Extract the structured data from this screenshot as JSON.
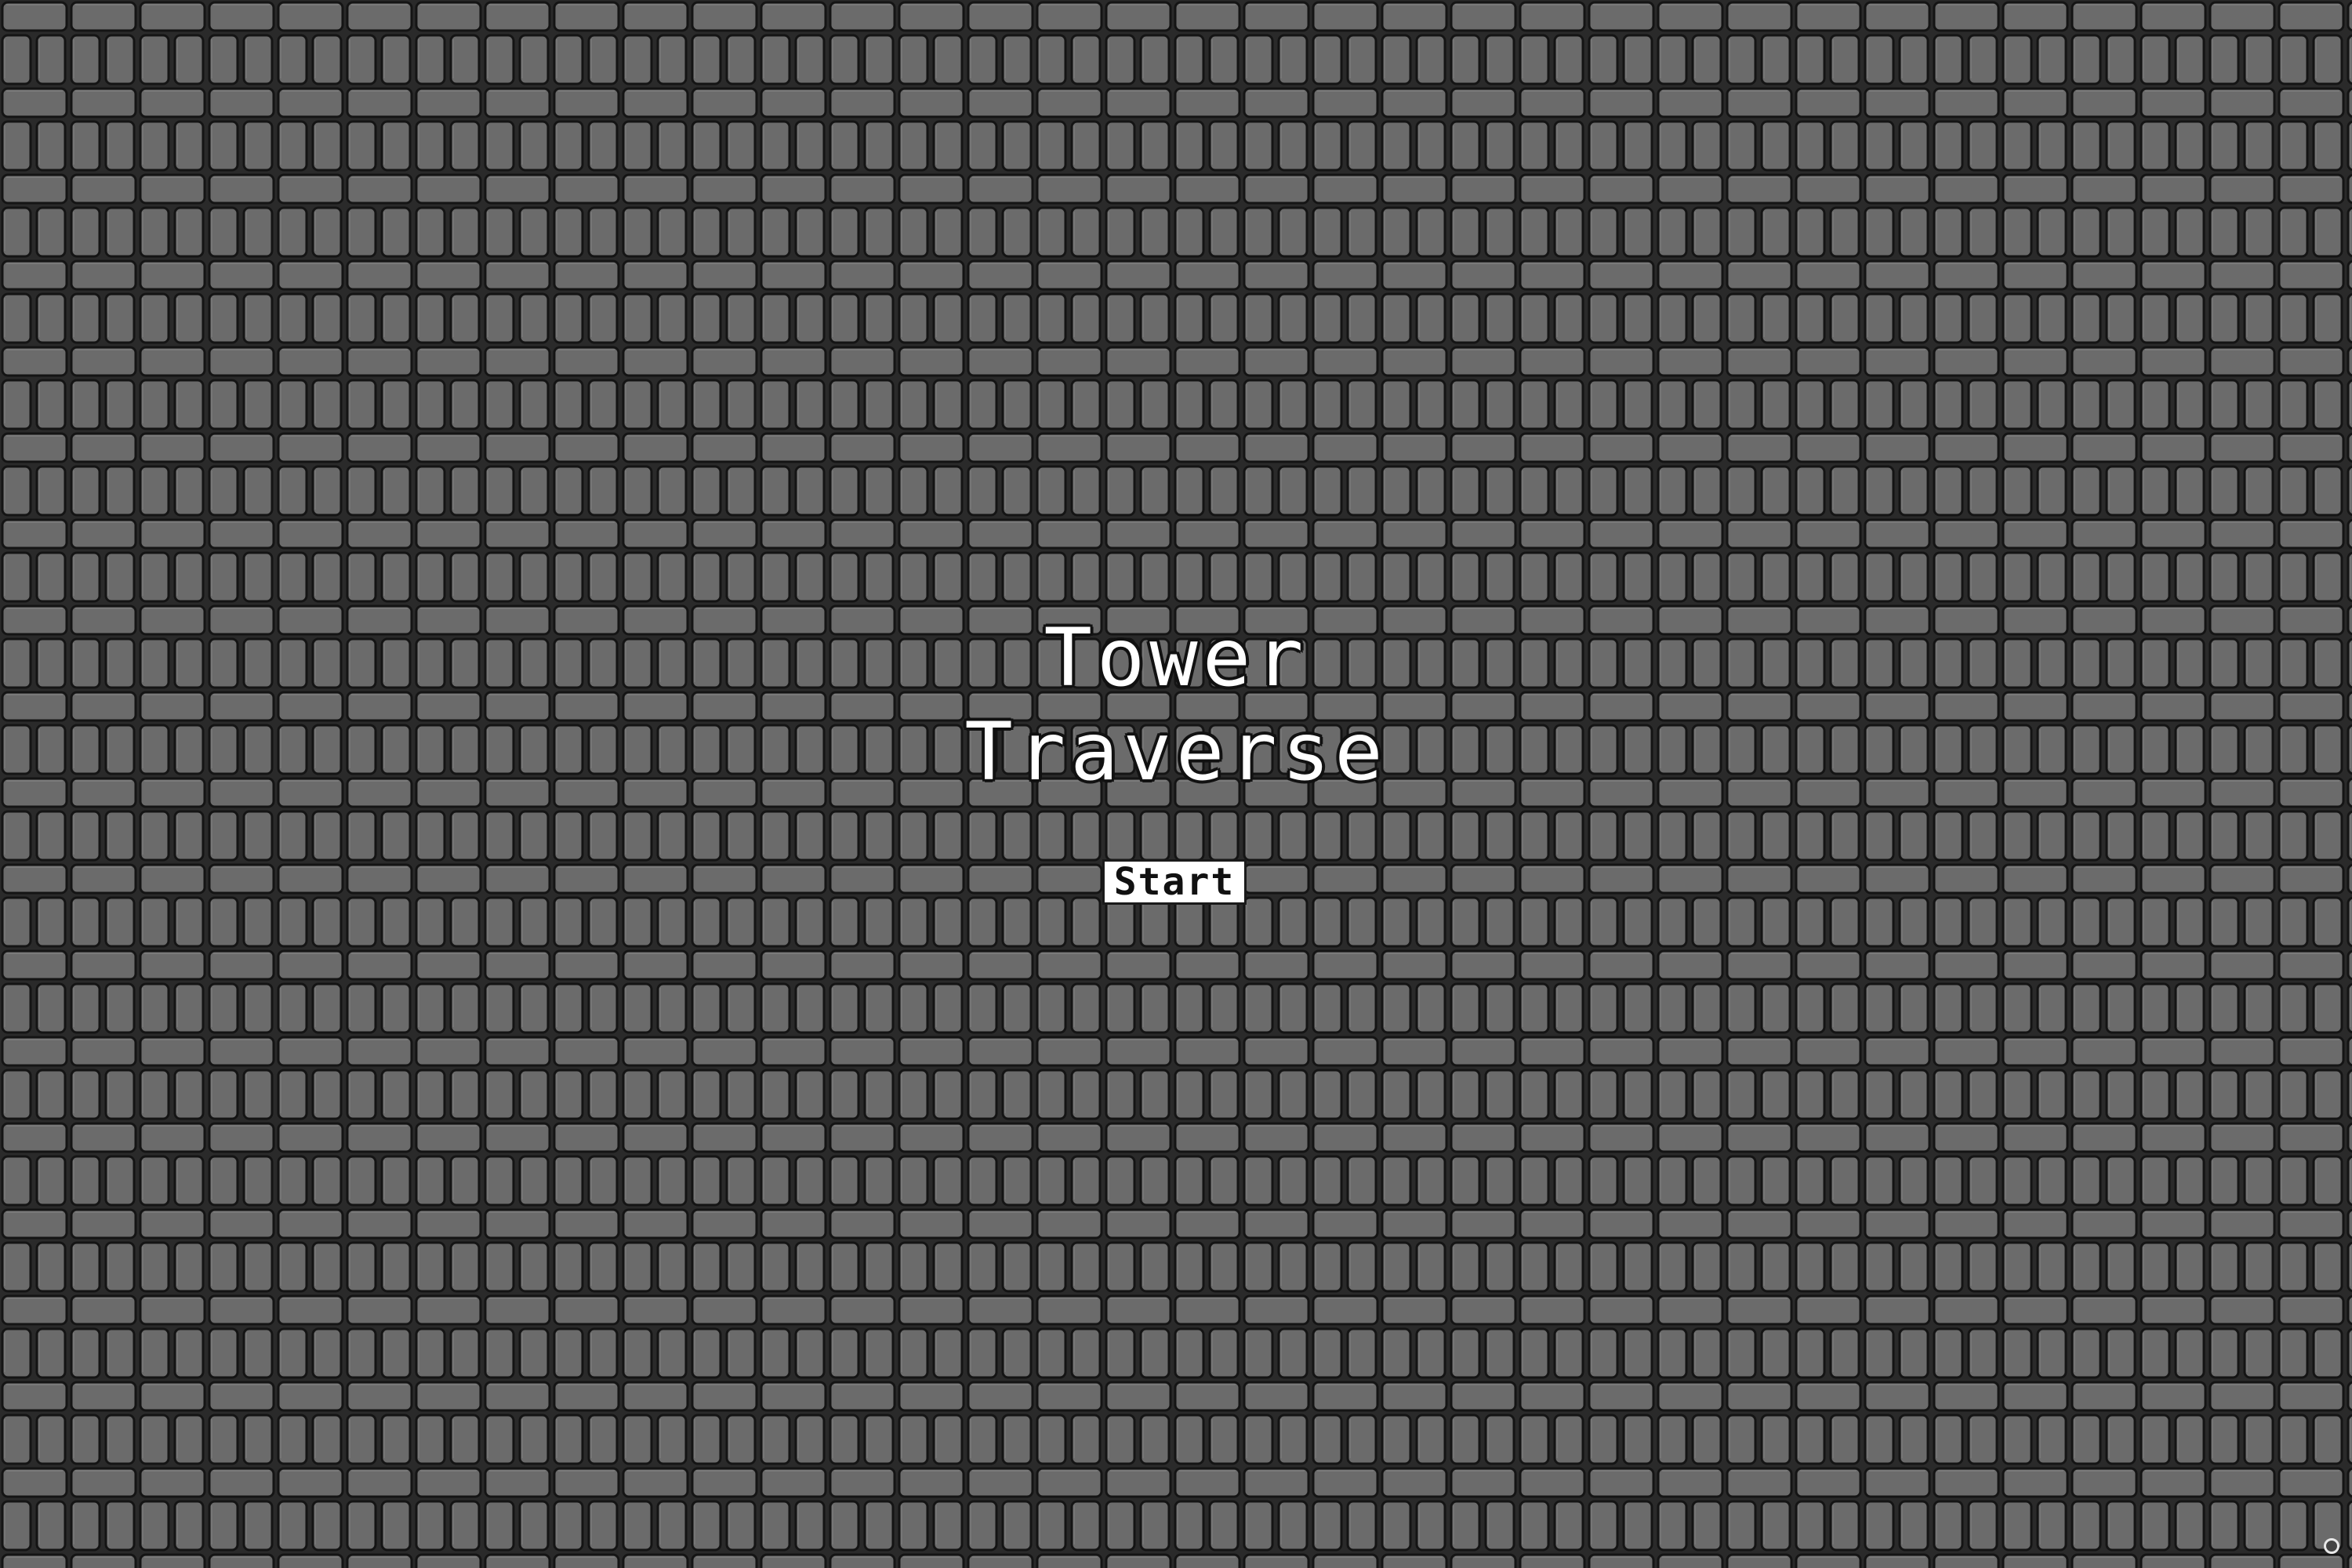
{
  "game": {
    "title_line1": "Tower",
    "title_line2": "Traverse",
    "start_label": "Start"
  },
  "colors": {
    "background": "#5f5f5f",
    "brick_fill": "#6b6b6b",
    "mortar": "#1e1e1e",
    "title_text": "#ffffff",
    "button_fill": "#ffffff",
    "button_text": "#111111"
  },
  "icons": {
    "corner": "circle-icon"
  }
}
